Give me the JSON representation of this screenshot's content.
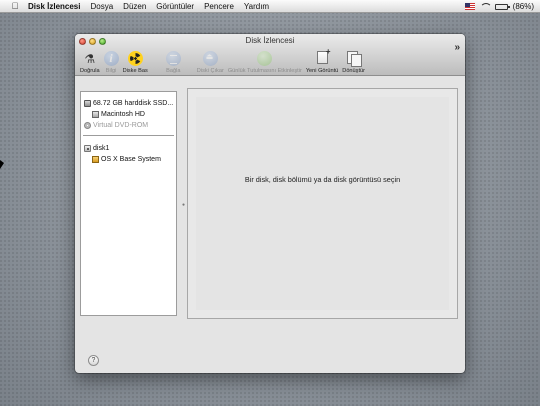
{
  "menubar": {
    "apple_icon": "apple-icon",
    "app_name": "Disk İzlencesi",
    "items": [
      "Dosya",
      "Düzen",
      "Görüntüler",
      "Pencere",
      "Yardım"
    ],
    "battery_text": "(86%)",
    "battery_level": 0.86
  },
  "window": {
    "title": "Disk İzlencesi",
    "toolbar": [
      {
        "label": "Doğrula",
        "icon": "microscope-icon",
        "enabled": true
      },
      {
        "label": "Bilgi",
        "icon": "info-icon",
        "enabled": false
      },
      {
        "label": "Diske Bas",
        "icon": "burn-icon",
        "enabled": true
      },
      {
        "label": "Bağla",
        "icon": "mount-icon",
        "enabled": false
      },
      {
        "label": "Diski Çıkar",
        "icon": "eject-icon",
        "enabled": false
      },
      {
        "label": "Günlük Tutulmasını Etkinleştir",
        "icon": "journal-icon",
        "enabled": false
      },
      {
        "label": "Yeni Görüntü",
        "icon": "new-image-icon",
        "enabled": true
      },
      {
        "label": "Dönüştür",
        "icon": "convert-icon",
        "enabled": true
      }
    ],
    "overflow_label": "»"
  },
  "sidebar": {
    "items": [
      {
        "label": "68.72 GB harddisk SSD...",
        "icon": "hard-disk-icon"
      },
      {
        "label": "Macintosh HD",
        "icon": "volume-icon"
      },
      {
        "label": "Virtual DVD-ROM",
        "icon": "dvd-icon"
      },
      {
        "label": "disk1",
        "icon": "disk-image-icon"
      },
      {
        "label": "OS X Base System",
        "icon": "osx-volume-icon"
      }
    ]
  },
  "content": {
    "prompt": "Bir disk, disk bölümü ya da disk görüntüsü seçin"
  },
  "help_label": "?"
}
